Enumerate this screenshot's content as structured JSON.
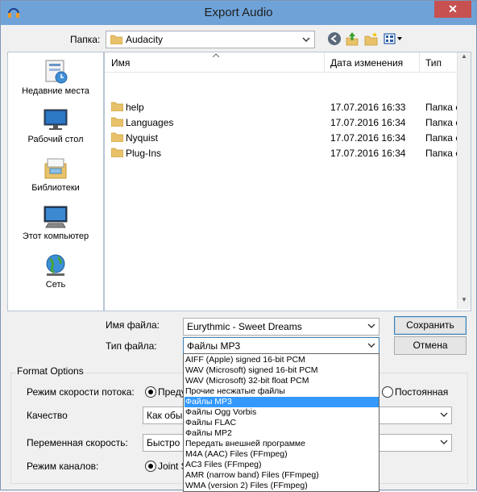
{
  "window": {
    "title": "Export Audio",
    "close_glyph": "✕"
  },
  "toolbar": {
    "lookin_label": "Папка:",
    "lookin_value": "Audacity",
    "icons": [
      "back-icon",
      "up-folder-icon",
      "new-folder-icon",
      "view-menu-icon"
    ]
  },
  "places": [
    {
      "label": "Недавние места",
      "icon": "recent-places-icon"
    },
    {
      "label": "Рабочий стол",
      "icon": "desktop-icon"
    },
    {
      "label": "Библиотеки",
      "icon": "libraries-icon"
    },
    {
      "label": "Этот компьютер",
      "icon": "computer-icon"
    },
    {
      "label": "Сеть",
      "icon": "network-icon"
    }
  ],
  "filelist": {
    "columns": {
      "name": "Имя",
      "date": "Дата изменения",
      "type": "Тип"
    },
    "rows": [
      {
        "name": "help",
        "date": "17.07.2016 16:33",
        "type": "Папка с ф"
      },
      {
        "name": "Languages",
        "date": "17.07.2016 16:34",
        "type": "Папка с ф"
      },
      {
        "name": "Nyquist",
        "date": "17.07.2016 16:34",
        "type": "Папка с ф"
      },
      {
        "name": "Plug-Ins",
        "date": "17.07.2016 16:34",
        "type": "Папка с ф"
      }
    ]
  },
  "form": {
    "filename_label": "Имя файла:",
    "filename_value": "Eurythmic - Sweet Dreams",
    "filetype_label": "Тип файла:",
    "filetype_value": "Файлы MP3",
    "save_button": "Сохранить",
    "cancel_button": "Отмена"
  },
  "format_options": {
    "title": "Format Options",
    "bitrate_mode_label": "Режим скорости потока:",
    "bitrate_mode_option1": "Преду",
    "bitrate_mode_option2": "Постоянная",
    "quality_label": "Качество",
    "quality_value": "Как обы",
    "variable_speed_label": "Переменная скорость:",
    "variable_speed_value": "Быстро",
    "channel_mode_label": "Режим каналов:",
    "channel_mode_option1": "Joint S"
  },
  "filetype_dropdown": {
    "selected_index": 4,
    "options": [
      "AIFF (Apple) signed 16-bit PCM",
      "WAV (Microsoft) signed 16-bit PCM",
      "WAV (Microsoft) 32-bit float PCM",
      "Прочие несжатые файлы",
      "Файлы MP3",
      "Файлы Ogg Vorbis",
      "Файлы FLAC",
      "Файлы MP2",
      "Передать внешней программе",
      "M4A (AAC) Files (FFmpeg)",
      "AC3 Files (FFmpeg)",
      "AMR (narrow band) Files (FFmpeg)",
      "WMA (version 2) Files (FFmpeg)"
    ]
  },
  "colors": {
    "titlebar": "#6fa3d8",
    "close_button": "#c75050",
    "selection": "#3399ff",
    "folder": "#e8c26a"
  }
}
